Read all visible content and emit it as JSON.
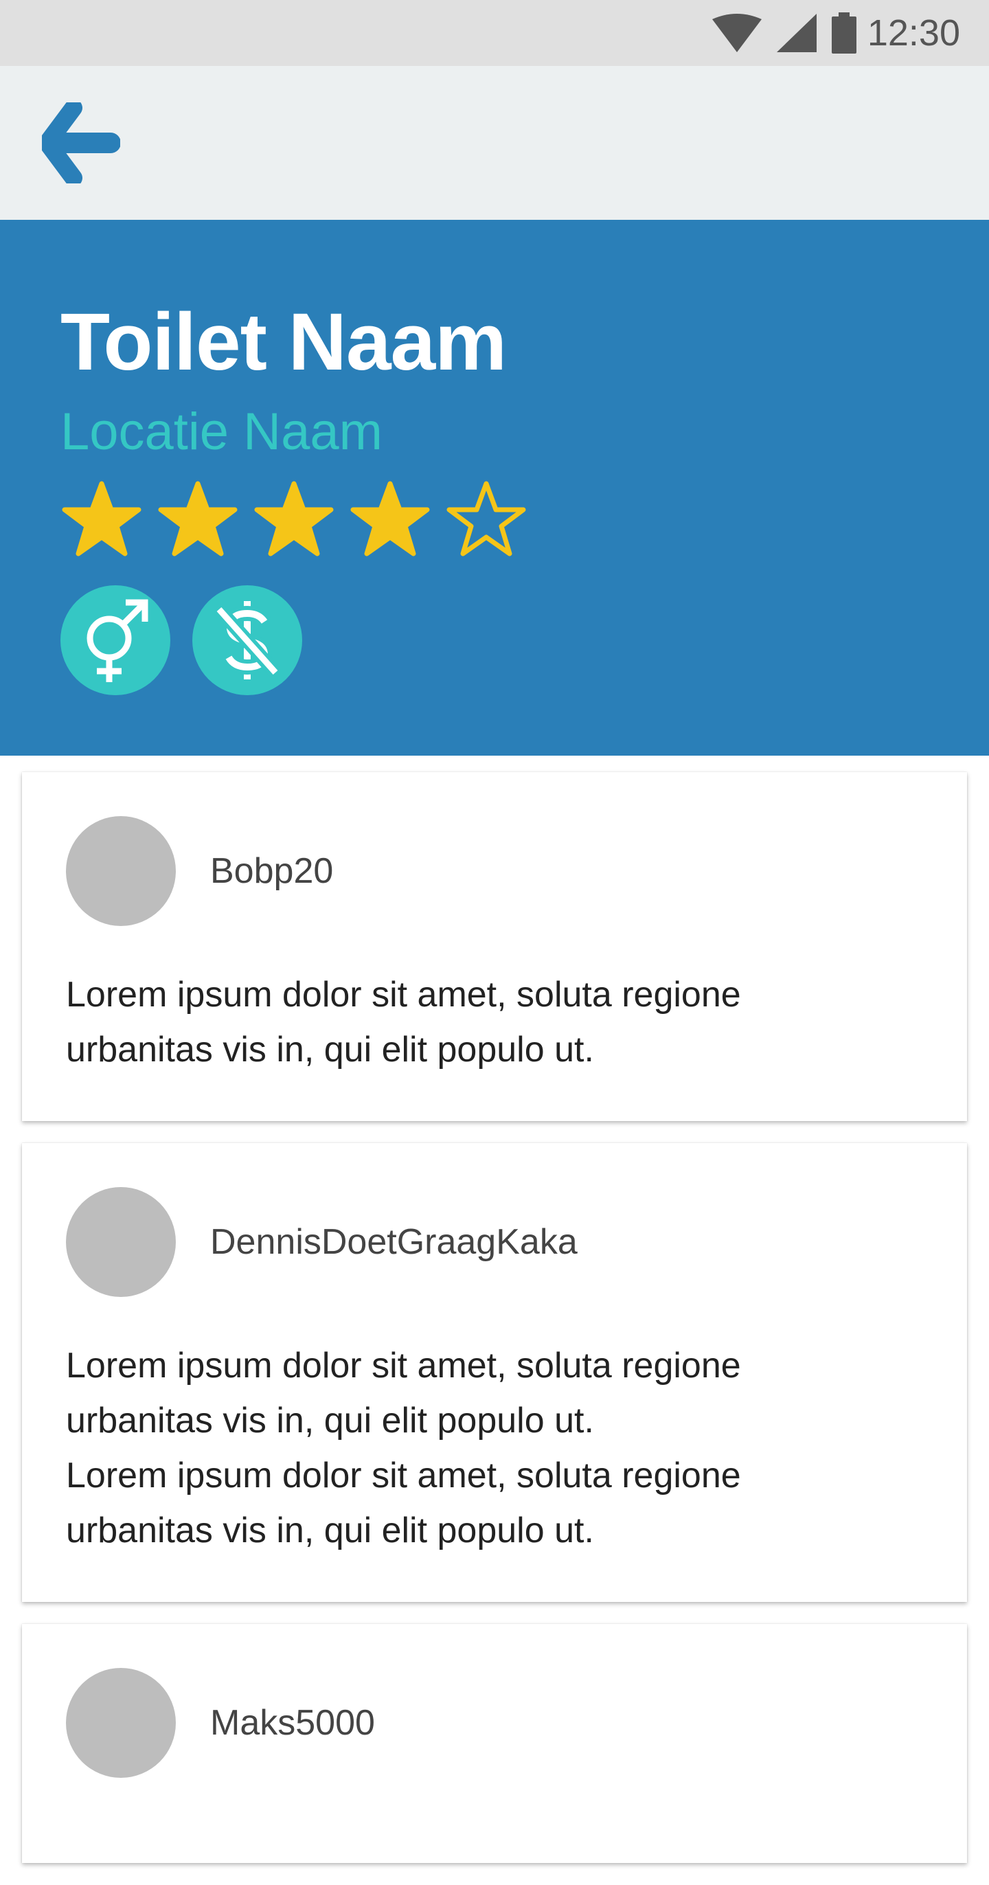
{
  "status_bar": {
    "time": "12:30"
  },
  "toolbar": {
    "back_icon": "arrow-left-icon"
  },
  "toilet": {
    "name": "Toilet Naam",
    "location": "Locatie Naam",
    "rating": 4,
    "rating_max": 5,
    "badges": [
      "gender-neutral-icon",
      "no-cost-icon"
    ]
  },
  "colors": {
    "accent_blue": "#2a7fb8",
    "teal": "#35c7c4",
    "star_yellow": "#f5c518"
  },
  "reviews": [
    {
      "username": "Bobp20",
      "text": "Lorem ipsum dolor sit amet, soluta regione\nurbanitas vis in, qui elit populo ut."
    },
    {
      "username": "DennisDoetGraagKaka",
      "text": "Lorem ipsum dolor sit amet, soluta regione\nurbanitas vis in, qui elit populo ut.\nLorem ipsum dolor sit amet, soluta regione\nurbanitas vis in, qui elit populo ut."
    },
    {
      "username": "Maks5000",
      "text": ""
    }
  ]
}
